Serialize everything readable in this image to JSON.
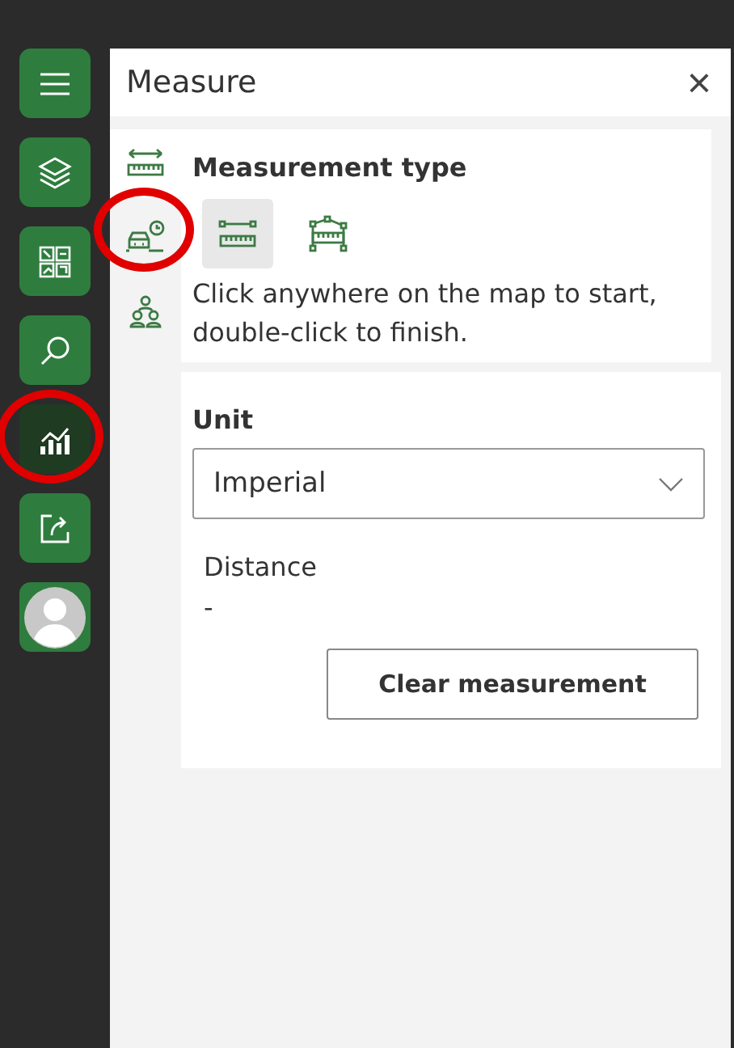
{
  "rail": [
    {
      "kind": "menu",
      "selected": false,
      "annotated": false
    },
    {
      "kind": "layers",
      "selected": false,
      "annotated": false
    },
    {
      "kind": "grid",
      "selected": false,
      "annotated": false
    },
    {
      "kind": "search",
      "selected": false,
      "annotated": false
    },
    {
      "kind": "chart",
      "selected": true,
      "annotated": true
    },
    {
      "kind": "share",
      "selected": false,
      "annotated": false
    },
    {
      "kind": "avatar",
      "selected": false,
      "annotated": false
    }
  ],
  "panel": {
    "title": "Measure",
    "close": "×",
    "tools": [
      {
        "kind": "ruler",
        "selected": true,
        "annotated": false
      },
      {
        "kind": "car",
        "selected": false,
        "annotated": true
      },
      {
        "kind": "people",
        "selected": false,
        "annotated": false
      }
    ],
    "measurement_type": {
      "label": "Measurement type",
      "options": [
        {
          "kind": "line",
          "selected": true
        },
        {
          "kind": "polyline",
          "selected": false
        }
      ],
      "hint": "Click anywhere on the map to start, double-click to finish."
    },
    "unit": {
      "label": "Unit",
      "value": "Imperial"
    },
    "distance": {
      "label": "Distance",
      "value": "-"
    },
    "clear_button": "Clear measurement"
  }
}
